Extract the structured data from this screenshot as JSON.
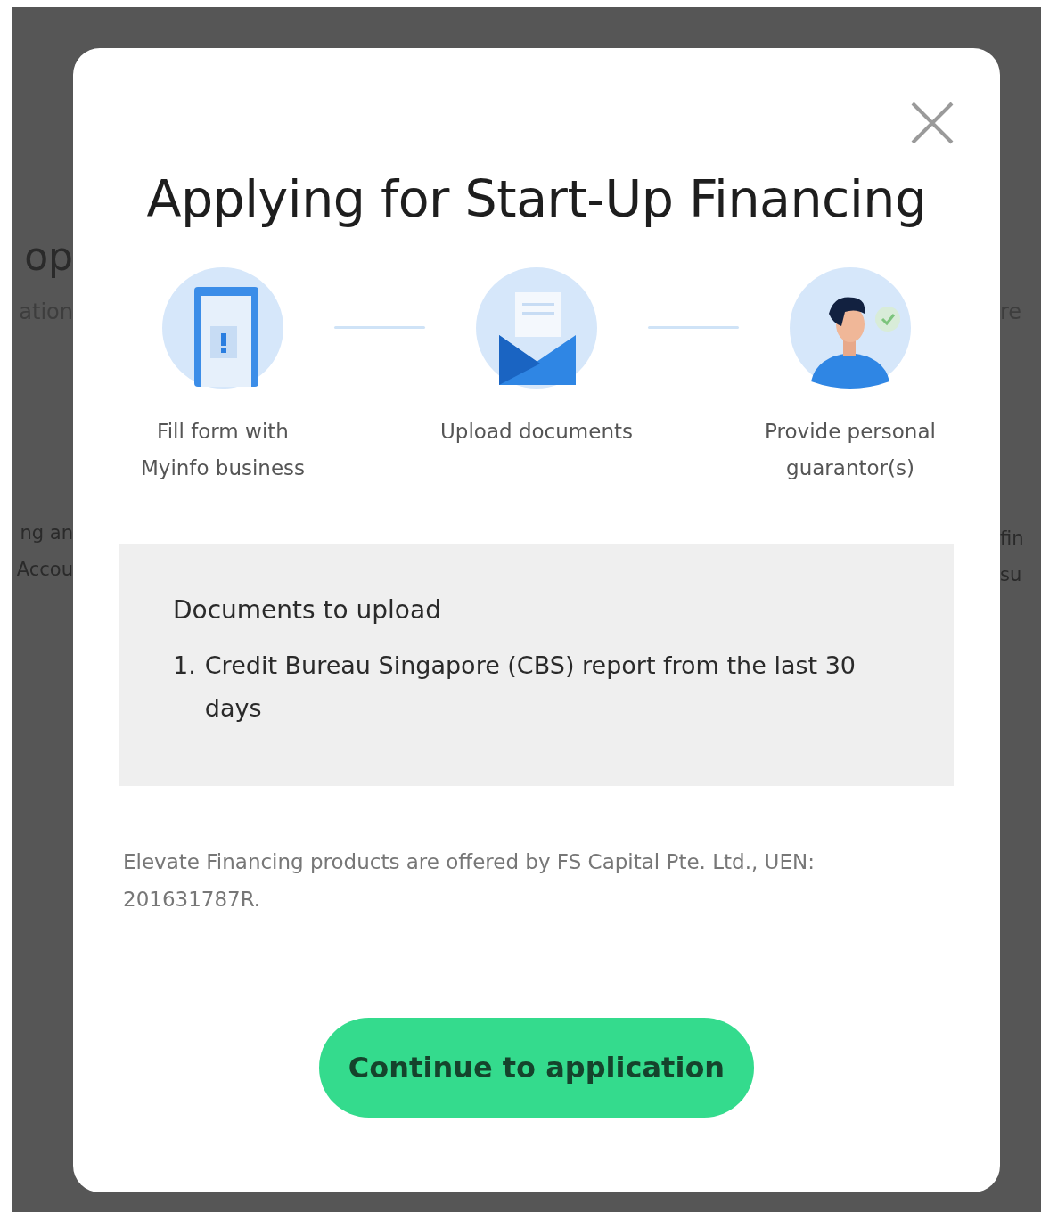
{
  "background": {
    "left_fragments": [
      {
        "text": "op",
        "kind": "heading"
      },
      {
        "text": "ation",
        "kind": "sub"
      },
      {
        "text": "ng an",
        "kind": "body"
      },
      {
        "text": "Accou",
        "kind": "body"
      }
    ],
    "right_fragments": [
      {
        "text": "re",
        "kind": "sub"
      },
      {
        "text": "fin",
        "kind": "body"
      },
      {
        "text": "su",
        "kind": "body"
      }
    ]
  },
  "dialog": {
    "title": "Applying for Start-Up Financing",
    "steps": [
      {
        "kind": "form",
        "label": "Fill form with Myinfo business"
      },
      {
        "kind": "upload",
        "label": "Upload documents"
      },
      {
        "kind": "guarantor",
        "label": "Provide personal guarantor(s)"
      }
    ],
    "documents": {
      "heading": "Documents to upload",
      "items": [
        {
          "marker": "1.",
          "text": "Credit Bureau Singapore (CBS) report from the last 30 days"
        }
      ]
    },
    "disclaimer": "Elevate Financing products are offered by FS Capital Pte. Ltd., UEN: 201631787R.",
    "button": "Continue to application"
  }
}
